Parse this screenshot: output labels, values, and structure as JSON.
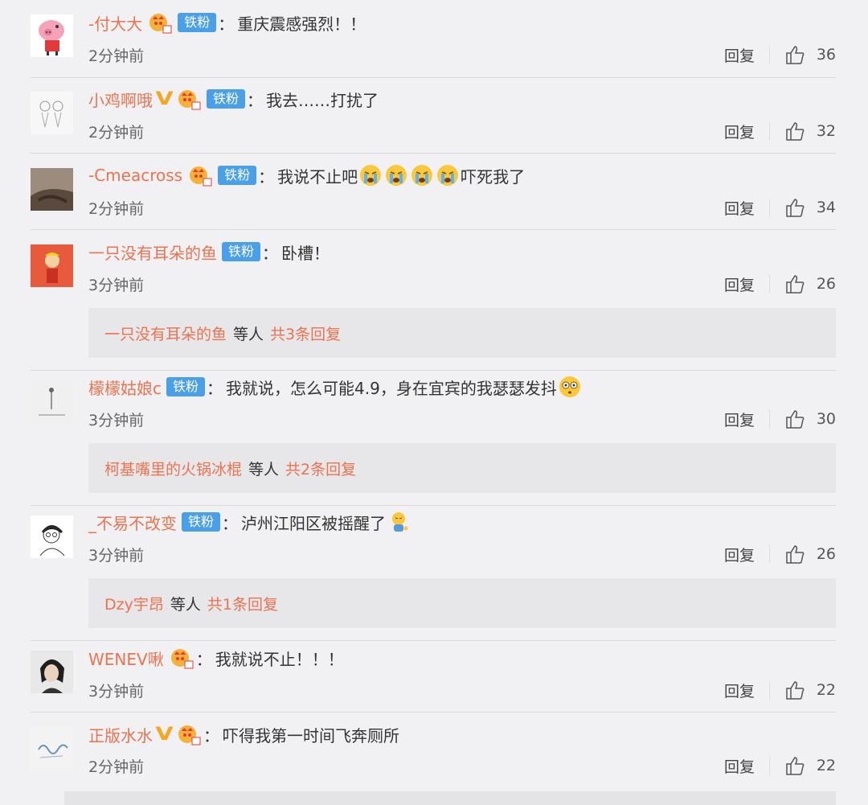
{
  "ui": {
    "reply_label": "回复",
    "badge_label": "铁粉",
    "colon": "："
  },
  "comments": [
    {
      "user": "-付大大",
      "text": "重庆震感强烈！！",
      "time": "2分钟前",
      "likes": "36",
      "has_v": false,
      "has_badge": true
    },
    {
      "user": "小鸡啊哦",
      "text": "我去……打扰了",
      "time": "2分钟前",
      "likes": "32",
      "has_v": true,
      "has_badge": true
    },
    {
      "user": "-Cmeacross",
      "text": "我说不止吧",
      "text_after": "吓死我了",
      "time": "2分钟前",
      "likes": "34",
      "has_v": false,
      "has_badge": true
    },
    {
      "user": "一只没有耳朵的鱼",
      "text": "卧槽！",
      "time": "3分钟前",
      "likes": "26",
      "has_v": false,
      "has_badge": true,
      "sub": {
        "user": "一只没有耳朵的鱼",
        "mid": "等人",
        "total": "共3条回复"
      }
    },
    {
      "user": "檬檬姑娘c",
      "text": "我就说，怎么可能4.9，身在宜宾的我瑟瑟发抖",
      "time": "3分钟前",
      "likes": "30",
      "has_v": false,
      "has_badge": true,
      "sub": {
        "user": "柯基嘴里的火锅冰棍",
        "mid": "等人",
        "total": "共2条回复"
      }
    },
    {
      "user": "_不易不改变",
      "text": "泸州江阳区被摇醒了",
      "time": "3分钟前",
      "likes": "26",
      "has_v": false,
      "has_badge": true,
      "sub": {
        "user": "Dzy宇昂",
        "mid": "等人",
        "total": "共1条回复"
      }
    },
    {
      "user": "WENEV啾",
      "text": "我就说不止！！！",
      "time": "3分钟前",
      "likes": "22",
      "has_v": false,
      "has_badge": false
    },
    {
      "user": "正版水水",
      "text": "吓得我第一时间飞奔厕所",
      "time": "2分钟前",
      "likes": "22",
      "has_v": true,
      "has_badge": false
    }
  ],
  "icons": {
    "like": "thumbs-up-icon",
    "crown": "crown-vip-icon",
    "crying": "crying-emoji-icon",
    "shocked": "shocked-emoji-icon",
    "sleepy": "sleepy-emoji-icon"
  },
  "colors": {
    "username": "#eb7350",
    "badge": "#4aa0e8",
    "vip": "#f5a623"
  }
}
